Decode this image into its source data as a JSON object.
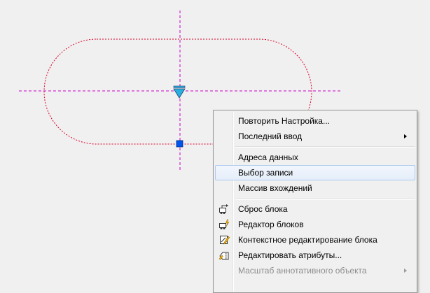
{
  "context_menu": {
    "items": [
      {
        "label": "Повторить Настройка..."
      },
      {
        "label": "Последний ввод"
      },
      {
        "label": "Адреса данных"
      },
      {
        "label": "Выбор записи"
      },
      {
        "label": "Массив вхождений"
      },
      {
        "label": "Сброс блока",
        "icon": "block-reset-icon"
      },
      {
        "label": "Редактор блоков",
        "icon": "block-editor-icon"
      },
      {
        "label": "Контекстное редактирование блока",
        "icon": "in-place-edit-icon"
      },
      {
        "label": "Редактировать атрибуты...",
        "icon": "edit-attributes-icon"
      },
      {
        "label": "Масштаб аннотативного объекта"
      }
    ]
  },
  "colors": {
    "object_outline": "#d9002a",
    "centerline": "#c800c8",
    "grip": "#0055ee",
    "flip_grip": "#29aee0",
    "menu_highlight_border": "#aecaf0"
  }
}
